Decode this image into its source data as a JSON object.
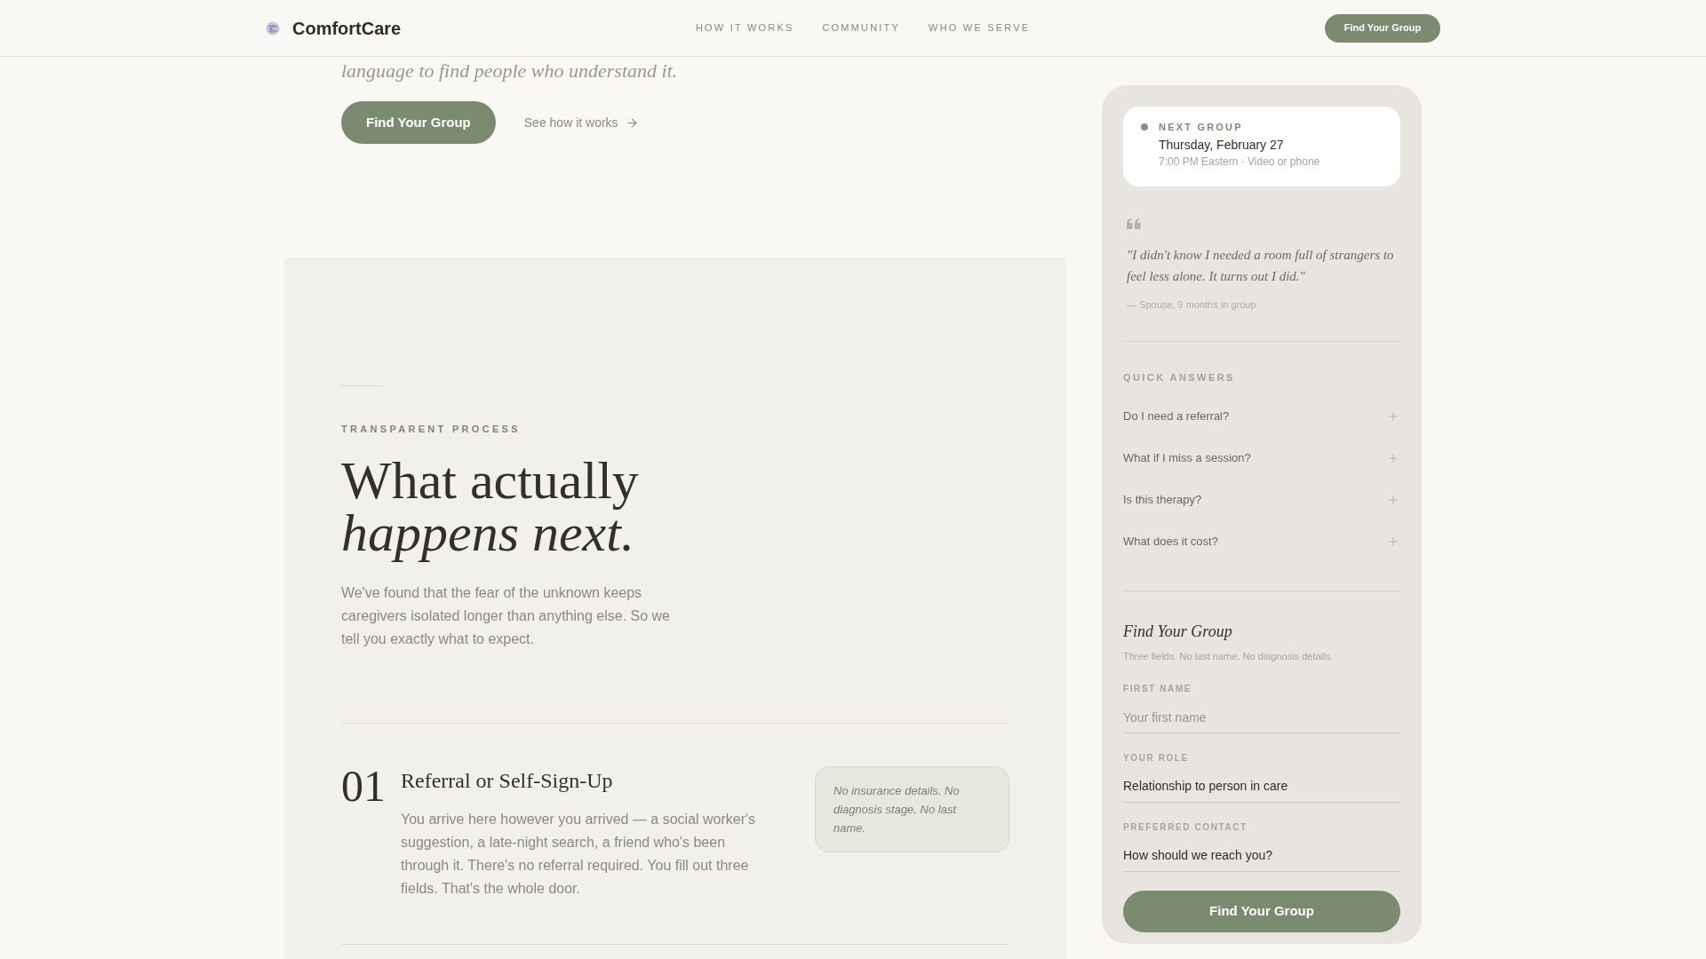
{
  "header": {
    "brand": "ComfortCare",
    "nav": [
      "HOW IT WORKS",
      "COMMUNITY",
      "WHO WE SERVE"
    ],
    "cta": "Find Your Group"
  },
  "hero": {
    "subtitle": "language to find people who understand it.",
    "primary_button": "Find Your Group",
    "secondary_link": "See how it works"
  },
  "process": {
    "eyebrow": "TRANSPARENT PROCESS",
    "heading": [
      {
        "text": "What actually",
        "italic": false
      },
      {
        "text": "happens next.",
        "italic": true
      }
    ],
    "intro": "We've found that the fear of the unknown keeps caregivers isolated longer than anything else. So we tell you exactly what to expect.",
    "steps": [
      {
        "number": "01",
        "title": "Referral or Self-Sign-Up",
        "body": "You arrive here however you arrived — a social worker's suggestion, a late-night search, a friend who's been through it. There's no referral required. You fill out three fields. That's the whole door.",
        "note": "No insurance details. No diagnosis stage. No last name."
      }
    ]
  },
  "sidebar": {
    "next_group": {
      "label": "NEXT GROUP",
      "date": "Thursday, February 27",
      "details": "7:00 PM Eastern · Video or phone"
    },
    "testimonial": {
      "quote": "\"I didn't know I needed a room full of strangers to feel less alone. It turns out I did.\"",
      "attribution": "— Spouse, 9 months in group"
    },
    "faq": {
      "title": "QUICK ANSWERS",
      "items": [
        {
          "question": "Do I need a referral?",
          "expanded": false
        },
        {
          "question": "What if I miss a session?",
          "expanded": false
        },
        {
          "question": "Is this therapy?",
          "expanded": false
        },
        {
          "question": "What does it cost?",
          "expanded": false
        }
      ]
    },
    "form": {
      "title": "Find Your Group",
      "subtitle": "Three fields. No last name. No diagnosis details.",
      "fields": [
        {
          "kind": "text",
          "label": "FIRST NAME",
          "placeholder": "Your first name"
        },
        {
          "kind": "select",
          "label": "YOUR ROLE",
          "value": "Relationship to person in care"
        },
        {
          "kind": "select",
          "label": "PREFERRED CONTACT",
          "value": "How should we reach you?"
        }
      ],
      "submit": "Find Your Group"
    }
  }
}
